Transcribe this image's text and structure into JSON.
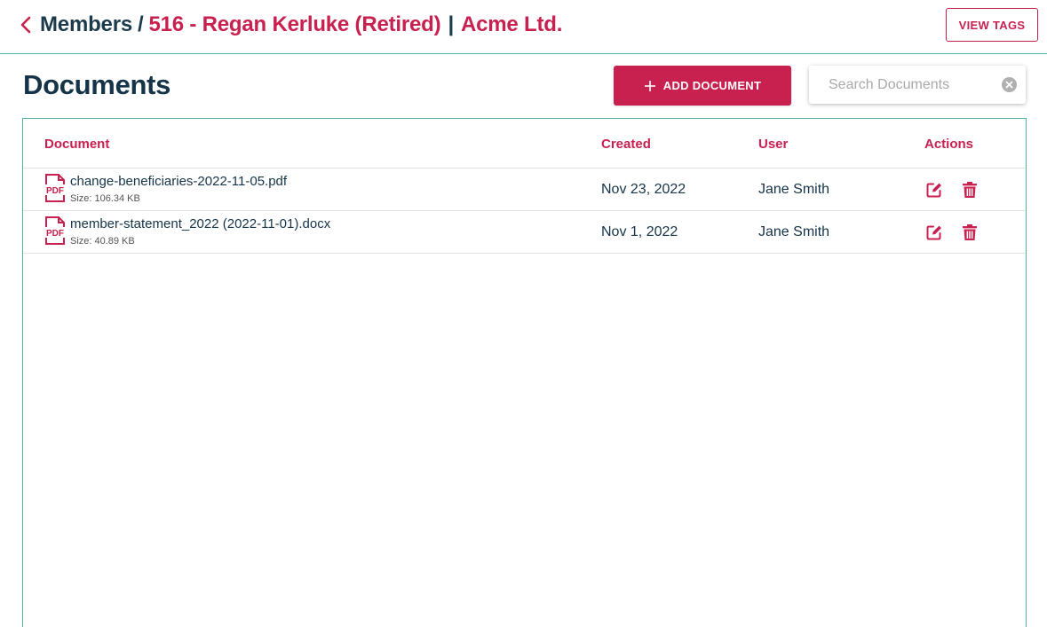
{
  "header": {
    "members_label": "Members",
    "separator": "/",
    "member_name": "516 - Regan Kerluke (Retired)",
    "divider": "|",
    "org_name": "Acme Ltd.",
    "view_tags_label": "VIEW TAGS"
  },
  "page": {
    "title": "Documents",
    "add_label": "ADD DOCUMENT",
    "search_placeholder": "Search Documents",
    "search_value": ""
  },
  "table": {
    "columns": [
      "Document",
      "Created",
      "User",
      "Actions"
    ],
    "size_label": "Size:",
    "rows": [
      {
        "icon_text": "PDF",
        "name": "change-beneficiaries-2022-11-05.pdf",
        "size": "106.34 KB",
        "created": "Nov 23, 2022",
        "user": "Jane Smith"
      },
      {
        "icon_text": "PDF",
        "name": "member-statement_2022 (2022-11-01).docx",
        "size": "40.89 KB",
        "created": "Nov 1, 2022",
        "user": "Jane Smith"
      }
    ]
  },
  "colors": {
    "accent": "#c8204f",
    "heading": "#153448",
    "border": "#4fb3a6"
  },
  "icons": {
    "back": "chevron-left-icon",
    "add": "plus-icon",
    "clear": "clear-circle-icon",
    "file": "pdf-file-icon",
    "edit": "edit-icon",
    "delete": "trash-icon"
  }
}
